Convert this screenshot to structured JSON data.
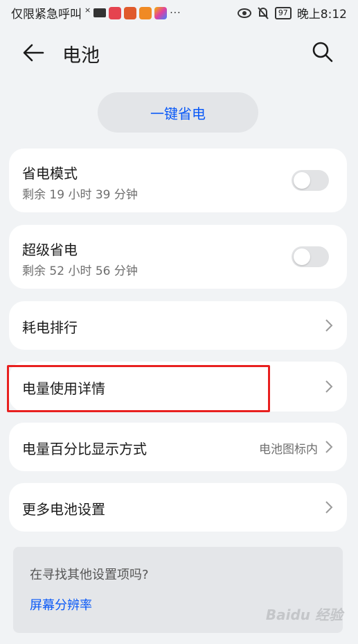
{
  "status_bar": {
    "carrier_text": "仅限紧急呼叫",
    "battery_level": "97",
    "time": "晚上8:12",
    "icons": [
      "no-signal-icon",
      "mail-icon",
      "app-icon-1",
      "app-icon-2",
      "app-icon-3",
      "app-icon-4",
      "more-dots-icon",
      "eye-icon",
      "mute-bell-icon",
      "battery-icon"
    ]
  },
  "header": {
    "title": "电池",
    "back_icon": "arrow-left-icon",
    "search_icon": "search-icon"
  },
  "one_tap": {
    "label": "一键省电"
  },
  "items": {
    "power_saving": {
      "title": "省电模式",
      "subtitle": "剩余 19 小时 39 分钟",
      "enabled": false
    },
    "super_saving": {
      "title": "超级省电",
      "subtitle": "剩余 52 小时 56 分钟",
      "enabled": false
    },
    "ranking": {
      "title": "耗电排行"
    },
    "usage_detail": {
      "title": "电量使用详情"
    },
    "percent_display": {
      "title": "电量百分比显示方式",
      "value": "电池图标内"
    },
    "more_settings": {
      "title": "更多电池设置"
    }
  },
  "suggestion": {
    "question": "在寻找其他设置项吗?",
    "link": "屏幕分辨率"
  },
  "watermark": "Baidu 经验",
  "colors": {
    "accent": "#0a59f7",
    "highlight": "#e8201f",
    "background": "#f1f3f5"
  }
}
